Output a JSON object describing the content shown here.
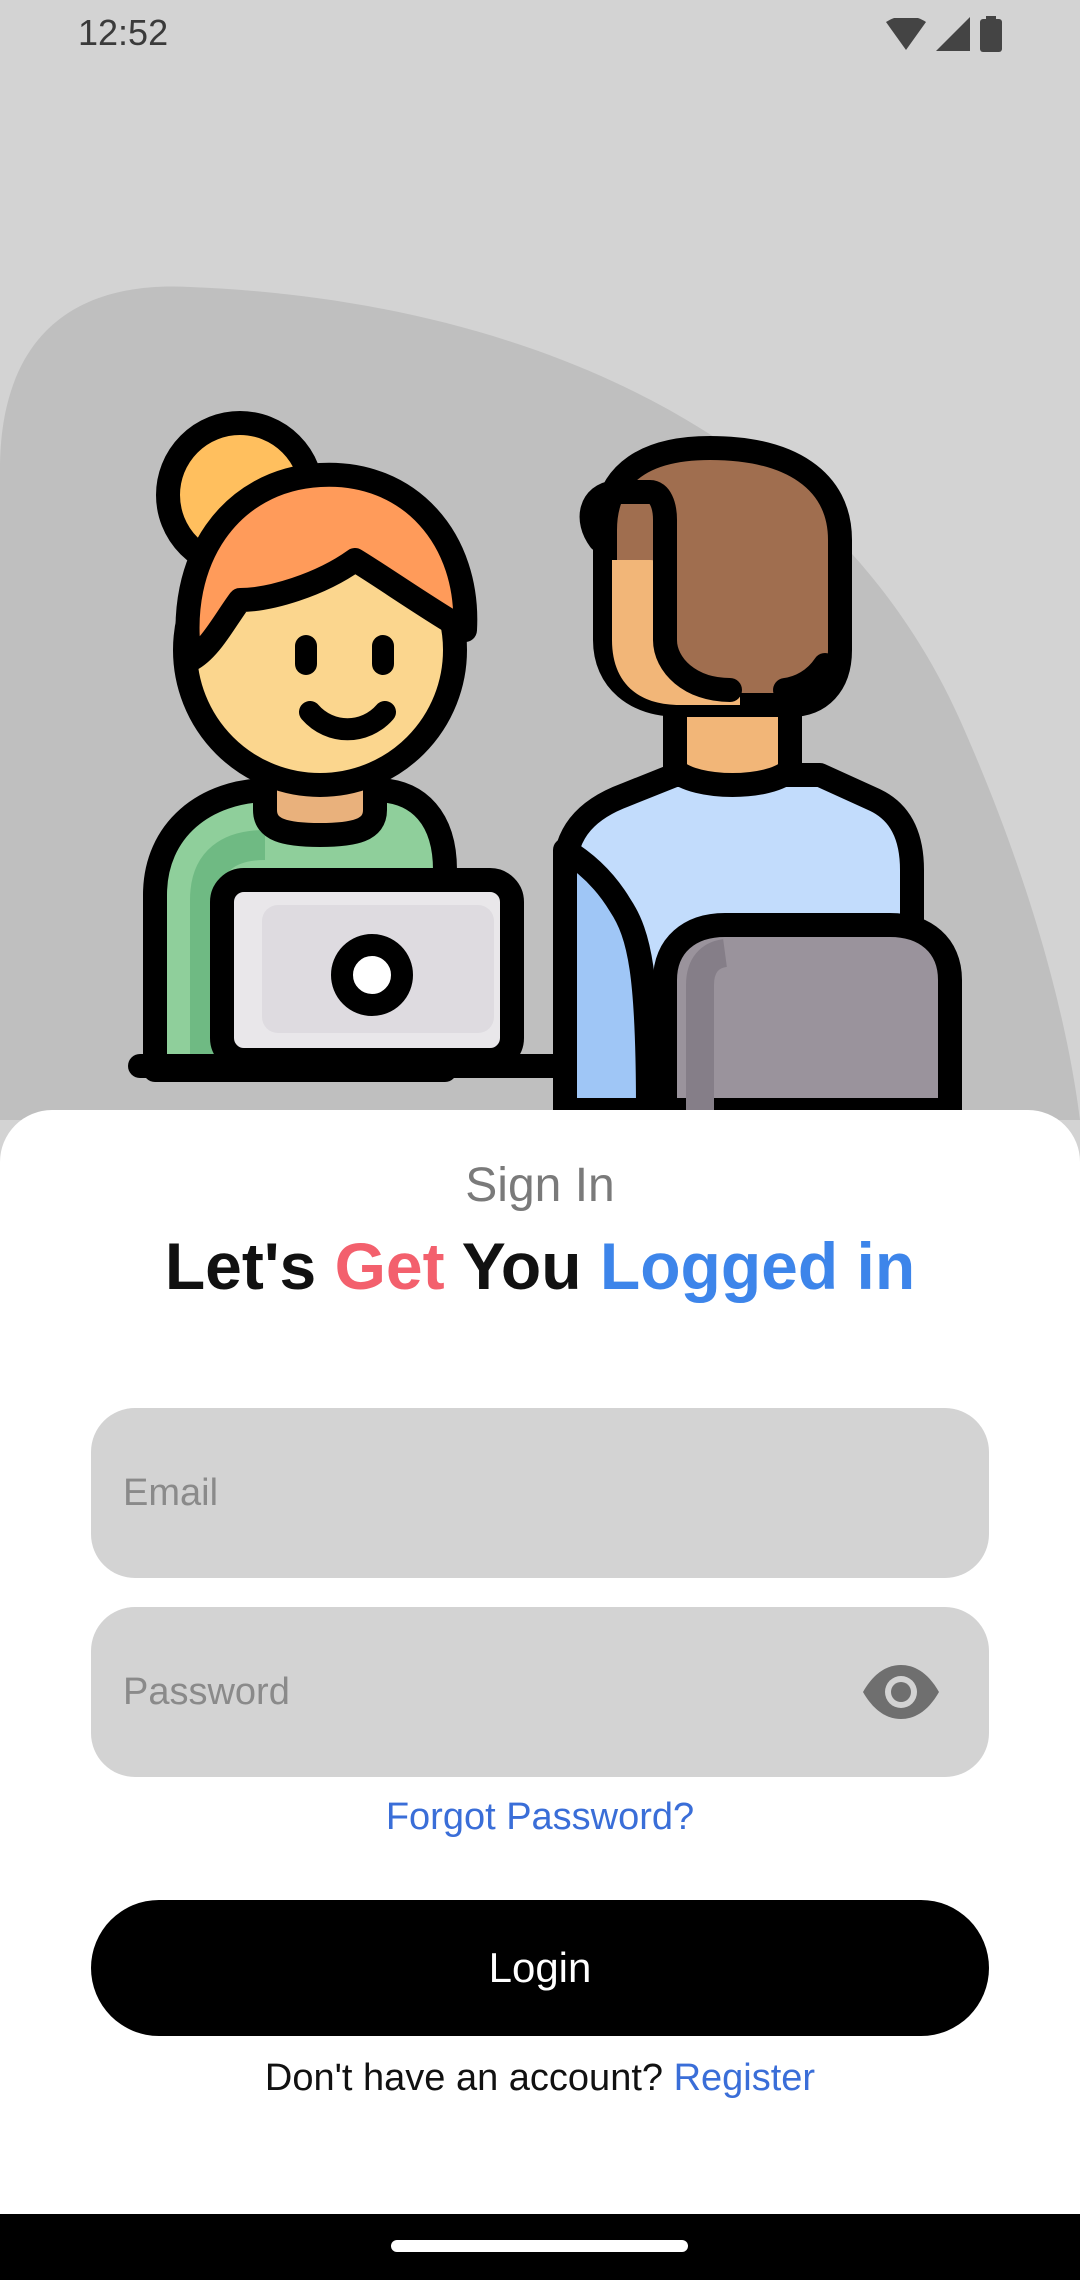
{
  "status_bar": {
    "time": "12:52",
    "icons": [
      "wifi-icon",
      "cellular-signal-icon",
      "battery-icon"
    ]
  },
  "hero": {
    "illustration": "two-people-laptop-illustration"
  },
  "auth": {
    "title": "Sign In",
    "headline": {
      "part1": "Let's ",
      "part2": "Get",
      "part3": " You ",
      "part4": "Logged in"
    },
    "email": {
      "value": "",
      "placeholder": "Email"
    },
    "password": {
      "value": "",
      "placeholder": "Password",
      "toggle_icon": "eye-icon"
    },
    "forgot_password": "Forgot Password?",
    "login_button": "Login",
    "register_prompt": "Don't have an account? ",
    "register_link": "Register"
  },
  "colors": {
    "background": "#d3d3d3",
    "accent_red": "#f3606d",
    "accent_blue": "#3d85ea",
    "link_blue": "#3a6ed8",
    "button": "#000000"
  }
}
